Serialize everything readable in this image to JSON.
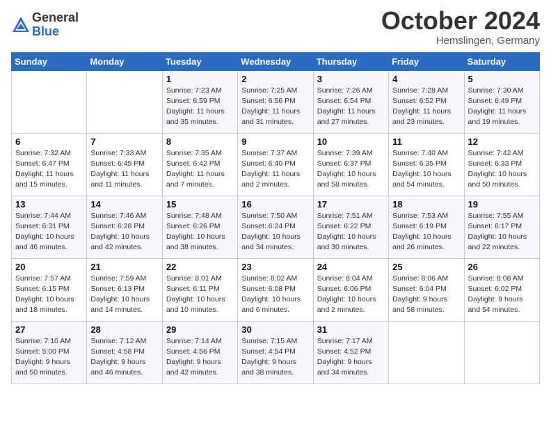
{
  "header": {
    "logo_general": "General",
    "logo_blue": "Blue",
    "month_title": "October 2024",
    "location": "Hemslingen, Germany"
  },
  "days_of_week": [
    "Sunday",
    "Monday",
    "Tuesday",
    "Wednesday",
    "Thursday",
    "Friday",
    "Saturday"
  ],
  "weeks": [
    [
      {
        "day": "",
        "info": ""
      },
      {
        "day": "",
        "info": ""
      },
      {
        "day": "1",
        "info": "Sunrise: 7:23 AM\nSunset: 6:59 PM\nDaylight: 11 hours\nand 35 minutes."
      },
      {
        "day": "2",
        "info": "Sunrise: 7:25 AM\nSunset: 6:56 PM\nDaylight: 11 hours\nand 31 minutes."
      },
      {
        "day": "3",
        "info": "Sunrise: 7:26 AM\nSunset: 6:54 PM\nDaylight: 11 hours\nand 27 minutes."
      },
      {
        "day": "4",
        "info": "Sunrise: 7:28 AM\nSunset: 6:52 PM\nDaylight: 11 hours\nand 23 minutes."
      },
      {
        "day": "5",
        "info": "Sunrise: 7:30 AM\nSunset: 6:49 PM\nDaylight: 11 hours\nand 19 minutes."
      }
    ],
    [
      {
        "day": "6",
        "info": "Sunrise: 7:32 AM\nSunset: 6:47 PM\nDaylight: 11 hours\nand 15 minutes."
      },
      {
        "day": "7",
        "info": "Sunrise: 7:33 AM\nSunset: 6:45 PM\nDaylight: 11 hours\nand 11 minutes."
      },
      {
        "day": "8",
        "info": "Sunrise: 7:35 AM\nSunset: 6:42 PM\nDaylight: 11 hours\nand 7 minutes."
      },
      {
        "day": "9",
        "info": "Sunrise: 7:37 AM\nSunset: 6:40 PM\nDaylight: 11 hours\nand 2 minutes."
      },
      {
        "day": "10",
        "info": "Sunrise: 7:39 AM\nSunset: 6:37 PM\nDaylight: 10 hours\nand 58 minutes."
      },
      {
        "day": "11",
        "info": "Sunrise: 7:40 AM\nSunset: 6:35 PM\nDaylight: 10 hours\nand 54 minutes."
      },
      {
        "day": "12",
        "info": "Sunrise: 7:42 AM\nSunset: 6:33 PM\nDaylight: 10 hours\nand 50 minutes."
      }
    ],
    [
      {
        "day": "13",
        "info": "Sunrise: 7:44 AM\nSunset: 6:31 PM\nDaylight: 10 hours\nand 46 minutes."
      },
      {
        "day": "14",
        "info": "Sunrise: 7:46 AM\nSunset: 6:28 PM\nDaylight: 10 hours\nand 42 minutes."
      },
      {
        "day": "15",
        "info": "Sunrise: 7:48 AM\nSunset: 6:26 PM\nDaylight: 10 hours\nand 38 minutes."
      },
      {
        "day": "16",
        "info": "Sunrise: 7:50 AM\nSunset: 6:24 PM\nDaylight: 10 hours\nand 34 minutes."
      },
      {
        "day": "17",
        "info": "Sunrise: 7:51 AM\nSunset: 6:22 PM\nDaylight: 10 hours\nand 30 minutes."
      },
      {
        "day": "18",
        "info": "Sunrise: 7:53 AM\nSunset: 6:19 PM\nDaylight: 10 hours\nand 26 minutes."
      },
      {
        "day": "19",
        "info": "Sunrise: 7:55 AM\nSunset: 6:17 PM\nDaylight: 10 hours\nand 22 minutes."
      }
    ],
    [
      {
        "day": "20",
        "info": "Sunrise: 7:57 AM\nSunset: 6:15 PM\nDaylight: 10 hours\nand 18 minutes."
      },
      {
        "day": "21",
        "info": "Sunrise: 7:59 AM\nSunset: 6:13 PM\nDaylight: 10 hours\nand 14 minutes."
      },
      {
        "day": "22",
        "info": "Sunrise: 8:01 AM\nSunset: 6:11 PM\nDaylight: 10 hours\nand 10 minutes."
      },
      {
        "day": "23",
        "info": "Sunrise: 8:02 AM\nSunset: 6:08 PM\nDaylight: 10 hours\nand 6 minutes."
      },
      {
        "day": "24",
        "info": "Sunrise: 8:04 AM\nSunset: 6:06 PM\nDaylight: 10 hours\nand 2 minutes."
      },
      {
        "day": "25",
        "info": "Sunrise: 8:06 AM\nSunset: 6:04 PM\nDaylight: 9 hours\nand 58 minutes."
      },
      {
        "day": "26",
        "info": "Sunrise: 8:08 AM\nSunset: 6:02 PM\nDaylight: 9 hours\nand 54 minutes."
      }
    ],
    [
      {
        "day": "27",
        "info": "Sunrise: 7:10 AM\nSunset: 5:00 PM\nDaylight: 9 hours\nand 50 minutes."
      },
      {
        "day": "28",
        "info": "Sunrise: 7:12 AM\nSunset: 4:58 PM\nDaylight: 9 hours\nand 46 minutes."
      },
      {
        "day": "29",
        "info": "Sunrise: 7:14 AM\nSunset: 4:56 PM\nDaylight: 9 hours\nand 42 minutes."
      },
      {
        "day": "30",
        "info": "Sunrise: 7:15 AM\nSunset: 4:54 PM\nDaylight: 9 hours\nand 38 minutes."
      },
      {
        "day": "31",
        "info": "Sunrise: 7:17 AM\nSunset: 4:52 PM\nDaylight: 9 hours\nand 34 minutes."
      },
      {
        "day": "",
        "info": ""
      },
      {
        "day": "",
        "info": ""
      }
    ]
  ]
}
